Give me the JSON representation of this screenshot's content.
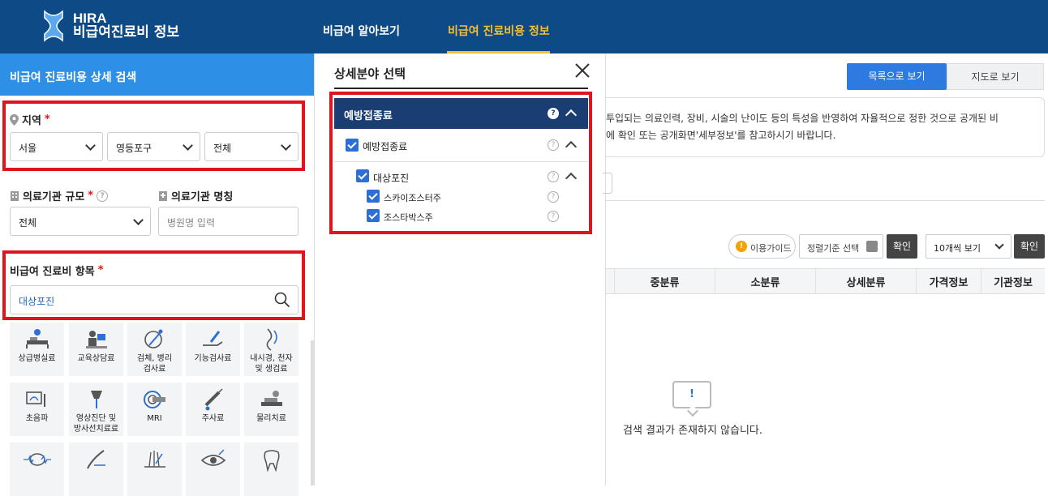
{
  "header": {
    "logo_line1": "HIRA",
    "logo_line2": "비급여진료비 정보",
    "nav": [
      "비급여 알아보기",
      "비급여 진료비용 정보"
    ],
    "brand_color": "#0e4a85",
    "active_color": "#f4c033"
  },
  "sidebar": {
    "title": "비급여 진료비용 상세 검색",
    "region_label": "지역",
    "required_mark": "*",
    "region_selects": [
      "서울",
      "영등포구",
      "전체"
    ],
    "scale_label": "의료기관 규모",
    "scale_value": "전체",
    "name_label": "의료기관 명칭",
    "name_placeholder": "병원명 입력",
    "item_label": "비급여 진료비 항목",
    "item_value": "대상포진",
    "tiles": [
      {
        "label": "상급병실료",
        "icon": "bed-icon"
      },
      {
        "label": "교육상담료",
        "icon": "counsel-icon"
      },
      {
        "label": "검체, 병리\n검사료",
        "icon": "microscope-icon"
      },
      {
        "label": "기능검사료",
        "icon": "hand-test-icon"
      },
      {
        "label": "내시경, 천자\n및 생검료",
        "icon": "endoscope-icon"
      },
      {
        "label": "초음파",
        "icon": "ultrasound-icon"
      },
      {
        "label": "영상진단 및\n방사선치료료",
        "icon": "radiology-icon"
      },
      {
        "label": "MRI",
        "icon": "mri-icon"
      },
      {
        "label": "주사료",
        "icon": "syringe-icon"
      },
      {
        "label": "물리치료",
        "icon": "physio-icon"
      },
      {
        "label": "",
        "icon": "brain-wave-icon"
      },
      {
        "label": "",
        "icon": "surgery-icon"
      },
      {
        "label": "",
        "icon": "hair-icon"
      },
      {
        "label": "",
        "icon": "eye-icon"
      },
      {
        "label": "",
        "icon": "tooth-icon"
      }
    ]
  },
  "popup": {
    "title": "상세분야 선택",
    "category": "예방접종료",
    "level1": "예방접종료",
    "level2": "대상포진",
    "level3": [
      "스카이조스터주",
      "조스타박스주"
    ],
    "qmark": "?"
  },
  "main": {
    "view_list": "목록으로 보기",
    "view_map": "지도로 보기",
    "notice_line1": "투입되는 의료인력, 장비, 시술의 난이도 등의 특성을 반영하여 자율적으로 정한 것으로 공개된 비",
    "notice_line2": "에 확인 또는 공개화면'세부정보'를 참고하시기 바랍니다.",
    "guide": "이용가이드",
    "sort_select": "정렬기준 선택",
    "confirm": "확인",
    "per_page": "10개씩 보기",
    "columns": [
      "중분류",
      "소분류",
      "상세분류",
      "가격정보",
      "기관정보"
    ],
    "empty_message": "검색 결과가 존재하지 않습니다.",
    "empty_mark": "!"
  }
}
